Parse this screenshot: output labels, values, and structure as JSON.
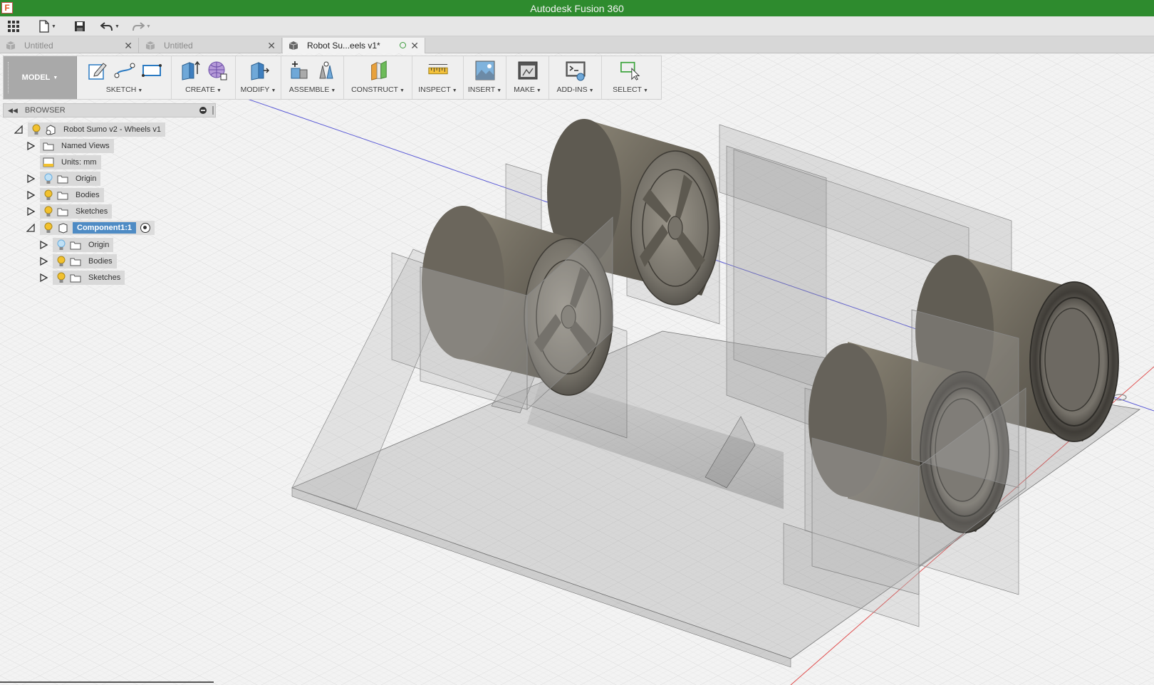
{
  "window": {
    "app_title": "Autodesk Fusion 360",
    "logo_letter": "F"
  },
  "quick_access": {
    "items": [
      "grid-menu",
      "file",
      "save",
      "undo",
      "redo"
    ]
  },
  "tabs": [
    {
      "label": "Untitled",
      "active": false
    },
    {
      "label": "Untitled",
      "active": false
    },
    {
      "label": "Robot Su...eels v1*",
      "active": true
    }
  ],
  "toolbar": {
    "workspace": "MODEL",
    "groups": [
      {
        "label": "SKETCH"
      },
      {
        "label": "CREATE"
      },
      {
        "label": "MODIFY"
      },
      {
        "label": "ASSEMBLE"
      },
      {
        "label": "CONSTRUCT"
      },
      {
        "label": "INSPECT"
      },
      {
        "label": "INSERT"
      },
      {
        "label": "MAKE"
      },
      {
        "label": "ADD-INS"
      },
      {
        "label": "SELECT"
      }
    ]
  },
  "browser": {
    "title": "BROWSER",
    "tree": [
      {
        "label": "Robot Sumo v2 - Wheels v1",
        "depth": 0,
        "expanded": true,
        "bulb": true,
        "kind": "document"
      },
      {
        "label": "Named Views",
        "depth": 1,
        "expanded": false,
        "bulb": false,
        "kind": "folder"
      },
      {
        "label": "Units: mm",
        "depth": 1,
        "expanded": null,
        "bulb": false,
        "kind": "units"
      },
      {
        "label": "Origin",
        "depth": 1,
        "expanded": false,
        "bulb": true,
        "bulb_color": "blue",
        "kind": "folder"
      },
      {
        "label": "Bodies",
        "depth": 1,
        "expanded": false,
        "bulb": true,
        "kind": "folder"
      },
      {
        "label": "Sketches",
        "depth": 1,
        "expanded": false,
        "bulb": true,
        "kind": "folder"
      },
      {
        "label": "Component1:1",
        "depth": 1,
        "expanded": true,
        "bulb": true,
        "kind": "component",
        "selected": true
      },
      {
        "label": "Origin",
        "depth": 2,
        "expanded": false,
        "bulb": true,
        "bulb_color": "blue",
        "kind": "folder"
      },
      {
        "label": "Bodies",
        "depth": 2,
        "expanded": false,
        "bulb": true,
        "kind": "folder"
      },
      {
        "label": "Sketches",
        "depth": 2,
        "expanded": false,
        "bulb": true,
        "kind": "folder"
      }
    ]
  },
  "colors": {
    "title_bar": "#2e8b2e",
    "selection": "#4e8bc4",
    "bulb": "#f2c12e",
    "bulb_blue": "#6aaee0"
  }
}
